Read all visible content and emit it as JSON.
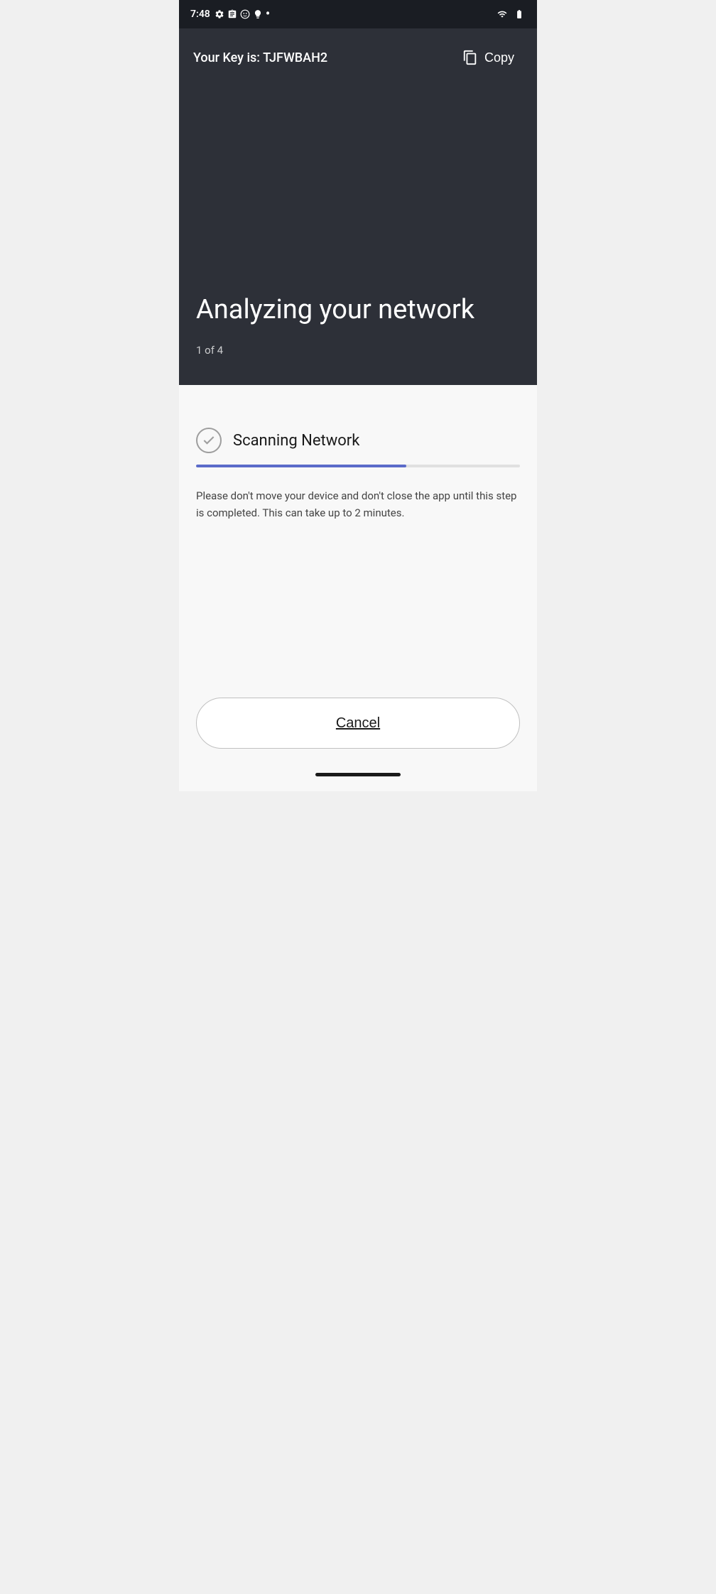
{
  "status_bar": {
    "time": "7:48",
    "icons": [
      "gear",
      "clipboard",
      "face",
      "bulb",
      "dot"
    ],
    "right_icons": [
      "wifi",
      "battery"
    ]
  },
  "key_bar": {
    "key_label": "Your Key is: TJFWBAH2",
    "copy_label": "Copy"
  },
  "hero": {
    "title": "Analyzing your network",
    "step": "1 of 4"
  },
  "content": {
    "scanning_label": "Scanning Network",
    "progress_percent": 65,
    "description": "Please don't move your device and don't close the app until this step is completed. This can take up to 2 minutes."
  },
  "footer": {
    "cancel_label": "Cancel"
  }
}
